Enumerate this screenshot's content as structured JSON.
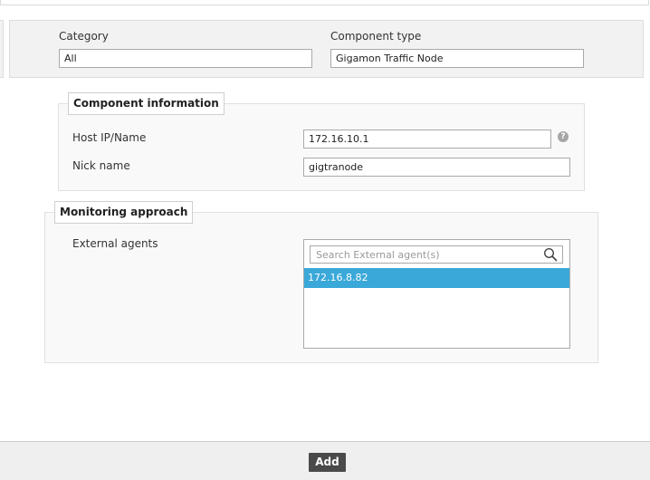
{
  "filters": {
    "category_label": "Category",
    "category_value": "All",
    "component_type_label": "Component type",
    "component_type_value": "Gigamon Traffic Node"
  },
  "component_information": {
    "legend": "Component information",
    "host_label": "Host IP/Name",
    "host_value": "172.16.10.1",
    "help_icon": "help-icon",
    "nick_label": "Nick name",
    "nick_value": "gigtranode"
  },
  "monitoring_approach": {
    "legend": "Monitoring approach",
    "external_agents_label": "External agents",
    "search_placeholder": "Search External agent(s)",
    "search_icon": "search-icon",
    "agents": [
      "172.16.8.82"
    ],
    "selected_color": "#3aa8d8"
  },
  "footer": {
    "add_label": "Add"
  }
}
